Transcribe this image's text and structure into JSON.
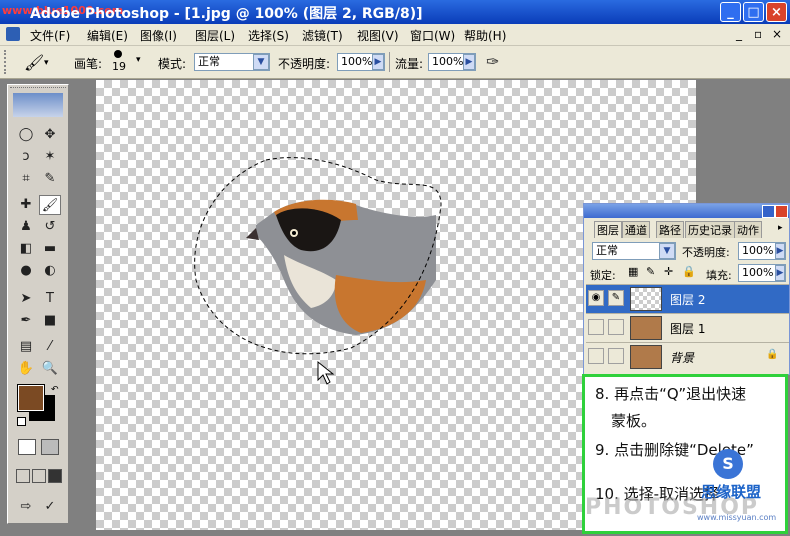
{
  "window": {
    "title": "Adobe Photoshop - [1.jpg @ 100% (图层 2, RGB/8)]",
    "watermark_corner": "www.blue1000.com",
    "buttons": [
      "_",
      "□",
      "×"
    ]
  },
  "menubar": {
    "items": [
      "文件(F)",
      "编辑(E)",
      "图像(I)",
      "图层(L)",
      "选择(S)",
      "滤镜(T)",
      "视图(V)",
      "窗口(W)",
      "帮助(H)"
    ],
    "doc_controls": [
      "_",
      "▫",
      "×"
    ]
  },
  "options": {
    "brush_label": "画笔:",
    "brush_size": "19",
    "mode_label": "模式:",
    "mode_value": "正常",
    "opacity_label": "不透明度:",
    "opacity_value": "100%",
    "flow_label": "流量:",
    "flow_value": "100%"
  },
  "colors": {
    "foreground": "#7b4a23",
    "background": "#000000",
    "selection": "#316ac5",
    "highlight_frame": "#2fd13b"
  },
  "layers_panel": {
    "tabs": [
      "图层",
      "通道",
      "路径",
      "历史记录",
      "动作"
    ],
    "blend_mode": "正常",
    "opacity_label": "不透明度:",
    "opacity_value": "100%",
    "lock_label": "锁定:",
    "fill_label": "填充:",
    "fill_value": "100%",
    "layers": [
      {
        "name": "图层 2",
        "selected": true
      },
      {
        "name": "图层 1",
        "selected": false
      },
      {
        "name": "背景",
        "selected": false
      }
    ]
  },
  "instructions": {
    "line1": "8. 再点击“Q”退出快速",
    "line2": "蒙板。",
    "line3": "9. 点击删除键“Delete”",
    "line4": "10. 选择-取消选择"
  },
  "watermark": {
    "text": "PHOTOSHOP",
    "brand": "思缘联盟",
    "url": "www.missyuan.com"
  }
}
